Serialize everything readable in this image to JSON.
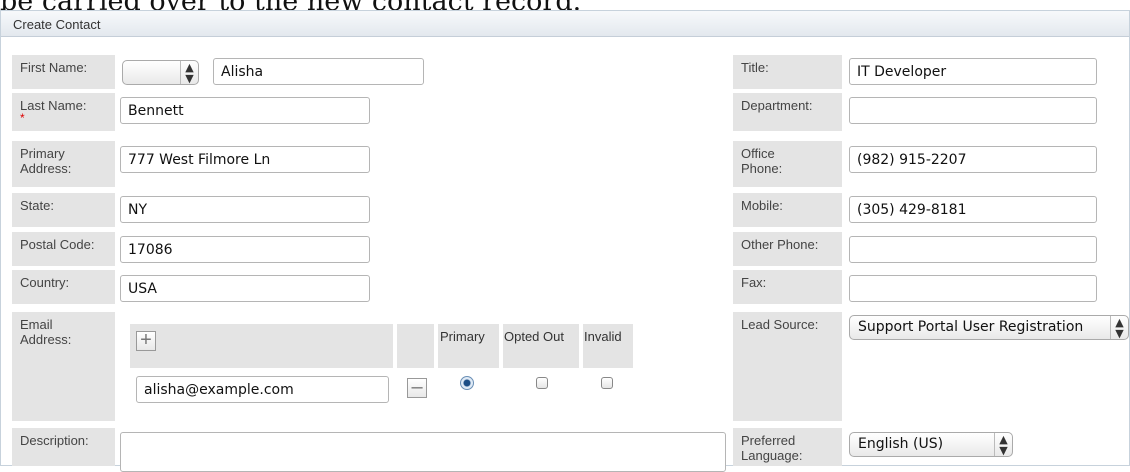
{
  "header_text": "be carried over to the new contact record.",
  "panel": {
    "title": "Create Contact"
  },
  "left": {
    "first_name": {
      "label": "First Name:",
      "salutation": "",
      "value": "Alisha"
    },
    "last_name": {
      "label": "Last Name:",
      "required_mark": "*",
      "value": "Bennett"
    },
    "primary_address": {
      "label": "Primary Address:",
      "value": "777 West Filmore Ln"
    },
    "state": {
      "label": "State:",
      "value": "NY"
    },
    "postal_code": {
      "label": "Postal Code:",
      "value": "17086"
    },
    "country": {
      "label": "Country:",
      "value": "USA"
    },
    "email": {
      "label": "Email Address:",
      "col_primary": "Primary",
      "col_opted_out": "Opted Out",
      "col_invalid": "Invalid",
      "value": "alisha@example.com",
      "primary_selected": true,
      "opted_out": false,
      "invalid": false
    },
    "description": {
      "label": "Description:",
      "value": ""
    }
  },
  "right": {
    "title": {
      "label": "Title:",
      "value": "IT Developer"
    },
    "department": {
      "label": "Department:",
      "value": ""
    },
    "office_phone": {
      "label": "Office Phone:",
      "value": "(982) 915-2207"
    },
    "mobile": {
      "label": "Mobile:",
      "value": "(305) 429-8181"
    },
    "other_phone": {
      "label": "Other Phone:",
      "value": ""
    },
    "fax": {
      "label": "Fax:",
      "value": ""
    },
    "lead_source": {
      "label": "Lead Source:",
      "value": "Support Portal User Registration"
    },
    "preferred_language": {
      "label": "Preferred Language:",
      "value": "English (US)"
    }
  },
  "icons": {
    "plus": "plus-icon",
    "minus": "minus-icon",
    "select_arrows": "up-down-arrows-icon"
  }
}
